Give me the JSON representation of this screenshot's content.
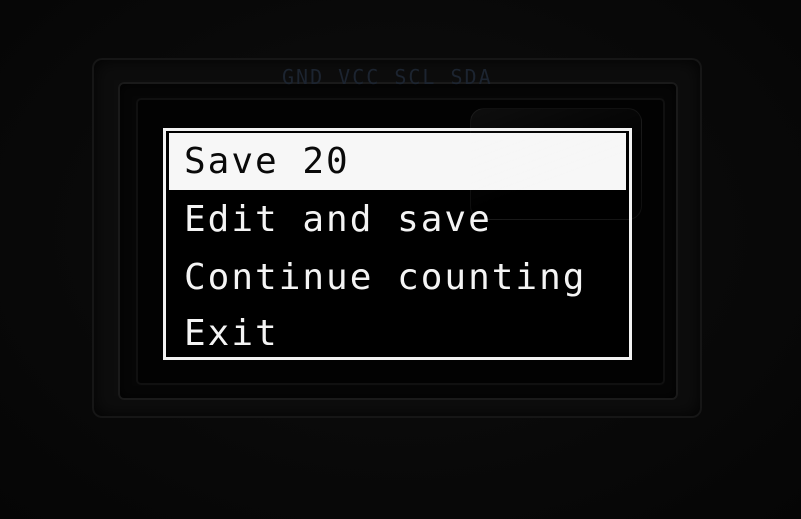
{
  "device": {
    "silkscreen_text": "GND VCC SCL SDA"
  },
  "menu": {
    "items": [
      {
        "label": "Save 20",
        "selected": true
      },
      {
        "label": "Edit and save",
        "selected": false
      },
      {
        "label": "Continue counting",
        "selected": false
      },
      {
        "label": "Exit",
        "selected": false
      }
    ]
  },
  "colors": {
    "screen_background": "#000000",
    "text": "#f4f4f4",
    "highlight": "#f7f7f7"
  }
}
